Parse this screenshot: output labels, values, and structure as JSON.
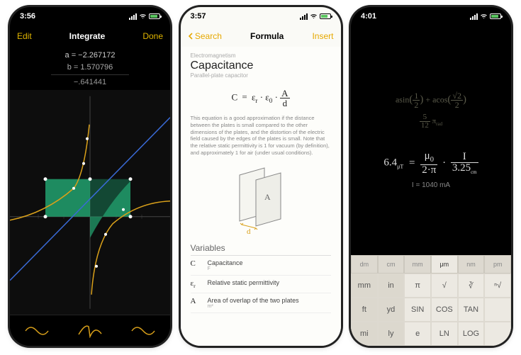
{
  "screen1": {
    "time": "3:56",
    "nav": {
      "left": "Edit",
      "title": "Integrate",
      "right": "Done"
    },
    "values": {
      "line1": "a = −2.267172",
      "line2": "b = 1.570796",
      "result": "−.641441"
    },
    "bottom_icons": [
      "wave-icon",
      "wave-cusp-icon",
      "wave-icon"
    ]
  },
  "screen2": {
    "time": "3:57",
    "nav": {
      "back": "Search",
      "title": "Formula",
      "right": "Insert"
    },
    "category": "Electromagnetism",
    "heading": "Capacitance",
    "subheading": "Parallel-plate capacitor",
    "formula": {
      "lhs": "C",
      "eq": "=",
      "f1": "ε",
      "f1s": "r",
      "dot": "·",
      "f2": "ε",
      "f2s": "0",
      "num": "A",
      "den": "d"
    },
    "description": "This equation is a good approximation if the distance between the plates is small compared to the other dimensions of the plates, and the distortion of the electric field caused by the edges of the plates is small. Note that the relative static permittivity is 1 for vacuum (by definition), and approximately 1 for air (under usual conditions).",
    "diagram": {
      "area_label": "A",
      "dist_label": "d"
    },
    "vars_heading": "Variables",
    "vars": [
      {
        "sym": "C",
        "label": "Capacitance",
        "unit": "F"
      },
      {
        "sym": "εr",
        "label": "Relative static permittivity",
        "unit": ""
      },
      {
        "sym": "A",
        "label": "Area of overlap of the two plates",
        "unit": "m²"
      }
    ]
  },
  "screen3": {
    "time": "4:01",
    "expr_top_raw": "asin(1/2) + acos(√2/2)",
    "expr_mid_raw": "5/12 π rad",
    "main": {
      "lhs": "6.4",
      "unit": "μT",
      "eq": "=",
      "n1": "μ",
      "n1s": "0",
      "d1a": "2·π",
      "n2": "I",
      "d2": "3.25",
      "d2u": "cm"
    },
    "subline": "I = 1040 mA",
    "tabs": [
      "dm",
      "cm",
      "mm",
      "μm",
      "nm",
      "pm"
    ],
    "tab_selected": 3,
    "keys": [
      [
        "mm",
        "in",
        "π",
        "√",
        "∛",
        "ⁿ√"
      ],
      [
        "ft",
        "yd",
        "SIN",
        "COS",
        "TAN",
        ""
      ],
      [
        "mi",
        "ly",
        "e",
        "LN",
        "LOG",
        ""
      ]
    ]
  }
}
